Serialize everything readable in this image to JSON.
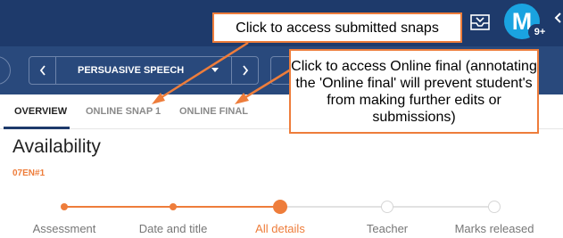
{
  "header": {
    "avatar_initial": "M",
    "notification_count": "9+"
  },
  "nav": {
    "assessment_selector": "PERSUASIVE SPEECH"
  },
  "tabs": [
    {
      "label": "OVERVIEW",
      "active": true
    },
    {
      "label": "ONLINE SNAP 1",
      "active": false
    },
    {
      "label": "ONLINE FINAL",
      "active": false
    }
  ],
  "page": {
    "title": "Availability",
    "class_code": "07EN#1"
  },
  "stepper": {
    "steps": [
      {
        "label": "Assessment",
        "state": "done"
      },
      {
        "label": "Date and title",
        "state": "done"
      },
      {
        "label": "All details",
        "state": "current"
      },
      {
        "label": "Teacher",
        "state": "pending"
      },
      {
        "label": "Marks released",
        "state": "pending"
      }
    ]
  },
  "annotations": {
    "snaps": "Click to access submitted snaps",
    "final": "Click to access Online final (annotating the 'Online final' will prevent student's from making further edits or submissions)"
  },
  "colors": {
    "header_bg": "#1e3a6b",
    "nav_bg": "#29497c",
    "accent": "#ee7d3b",
    "avatar_bg": "#1aa3e0"
  }
}
